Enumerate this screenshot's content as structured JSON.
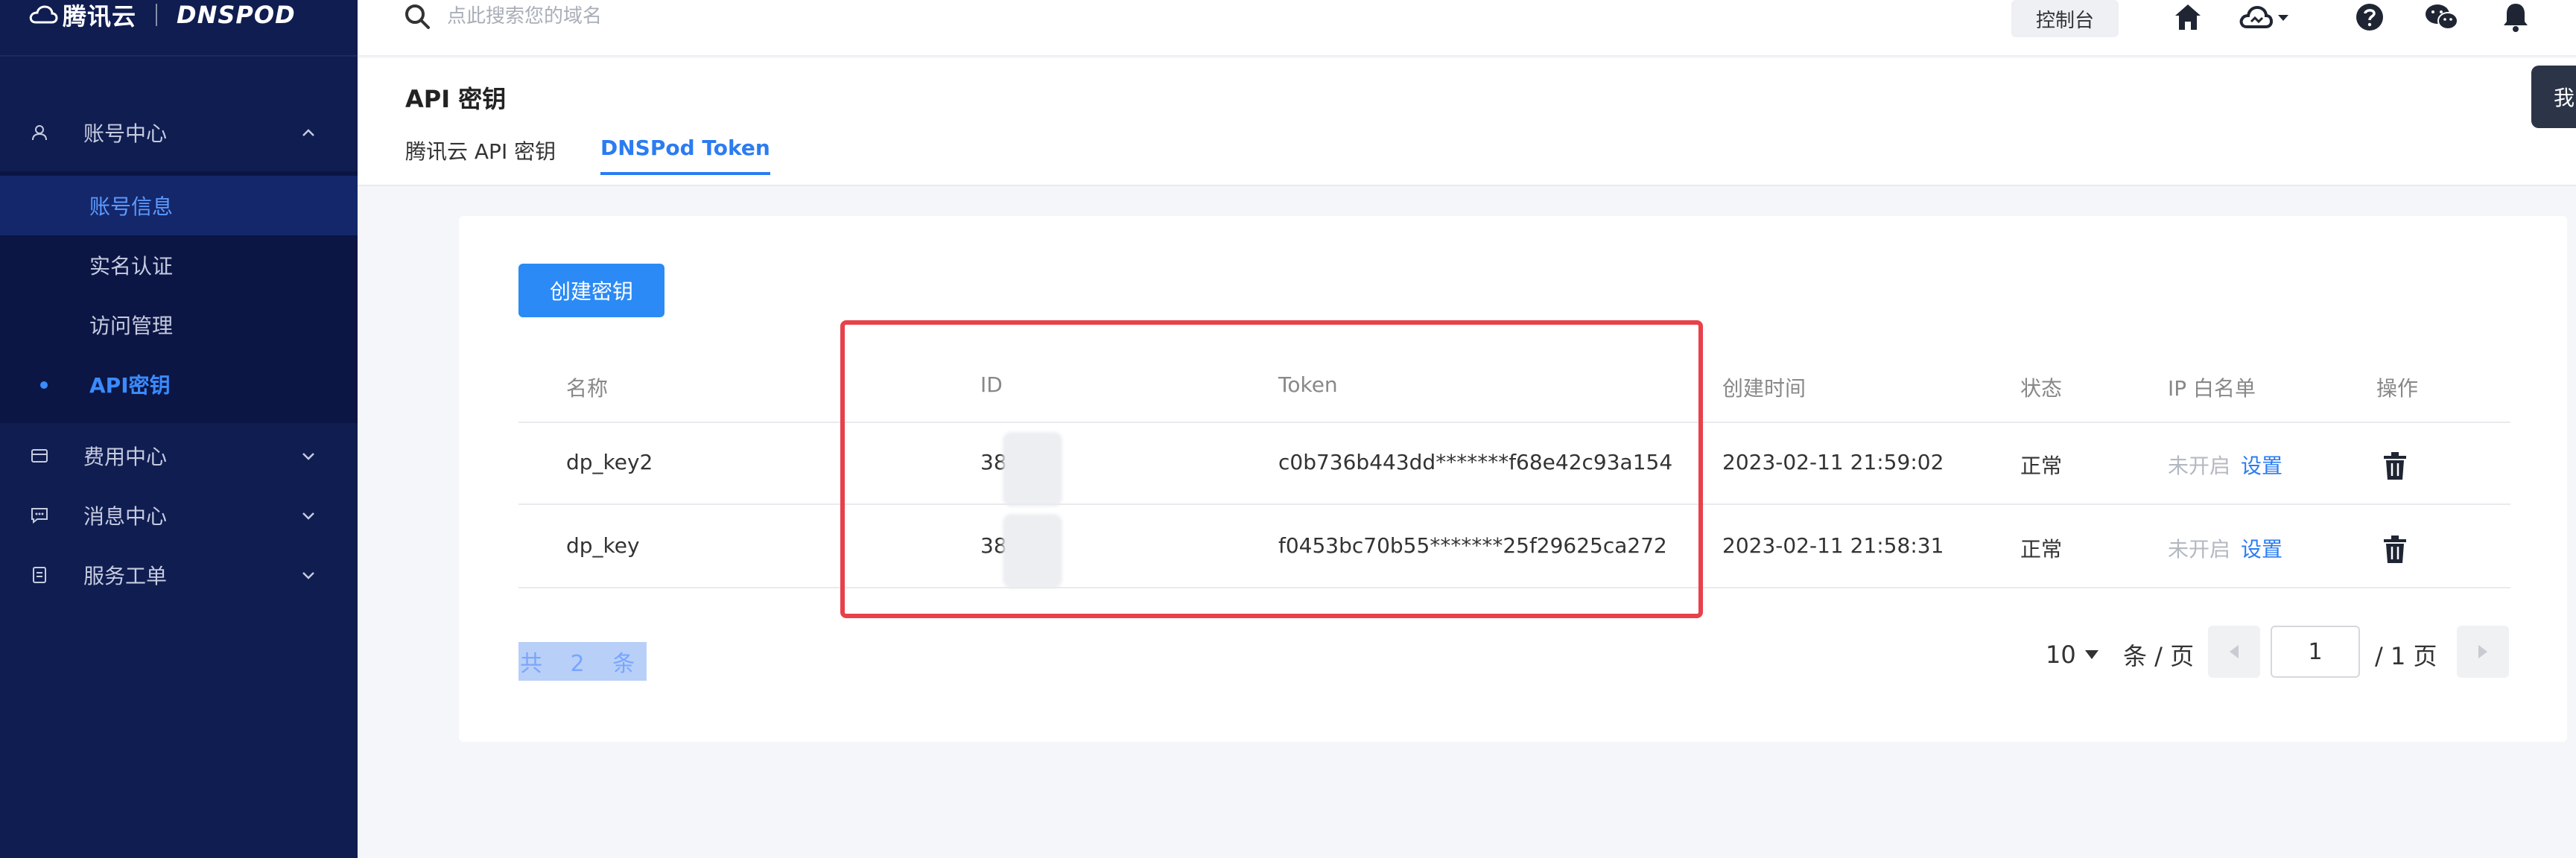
{
  "brand": {
    "name_cn": "腾讯云",
    "name_en": "DNSPOD"
  },
  "topbar": {
    "search_placeholder": "点此搜索您的域名",
    "console_label": "控制台"
  },
  "sidebar": {
    "groups": [
      {
        "label": "账号中心",
        "icon": "user-icon",
        "expanded": true
      },
      {
        "label": "费用中心",
        "icon": "wallet-icon",
        "expanded": false
      },
      {
        "label": "消息中心",
        "icon": "message-icon",
        "expanded": false
      },
      {
        "label": "服务工单",
        "icon": "ticket-icon",
        "expanded": false
      }
    ],
    "account_items": [
      {
        "label": "账号信息"
      },
      {
        "label": "实名认证"
      },
      {
        "label": "访问管理"
      },
      {
        "label": "API密钥"
      }
    ]
  },
  "page": {
    "title": "API 密钥",
    "tabs": [
      {
        "label": "腾讯云 API 密钥",
        "active": false
      },
      {
        "label": "DNSPod Token",
        "active": true
      }
    ],
    "side_tab_label": "我"
  },
  "table": {
    "create_button": "创建密钥",
    "columns": [
      "名称",
      "ID",
      "Token",
      "创建时间",
      "状态",
      "IP 白名单",
      "操作"
    ],
    "rows": [
      {
        "name": "dp_key2",
        "id": "38",
        "token": "c0b736b443dd*******f68e42c93a154",
        "created": "2023-02-11 21:59:02",
        "status": "正常",
        "whitelist": "未开启",
        "whitelist_action": "设置"
      },
      {
        "name": "dp_key",
        "id": "38",
        "token": "f0453bc70b55*******25f29625ca272",
        "created": "2023-02-11 21:58:31",
        "status": "正常",
        "whitelist": "未开启",
        "whitelist_action": "设置"
      }
    ]
  },
  "pagination": {
    "total_text": "共 2 条",
    "page_size": "10",
    "per_page_label": "条 / 页",
    "current_page": "1",
    "total_pages_label": "/ 1 页"
  },
  "colors": {
    "sidebar_bg": "#0f1d50",
    "accent": "#2b7cf2",
    "highlight_box": "#e8414a"
  }
}
